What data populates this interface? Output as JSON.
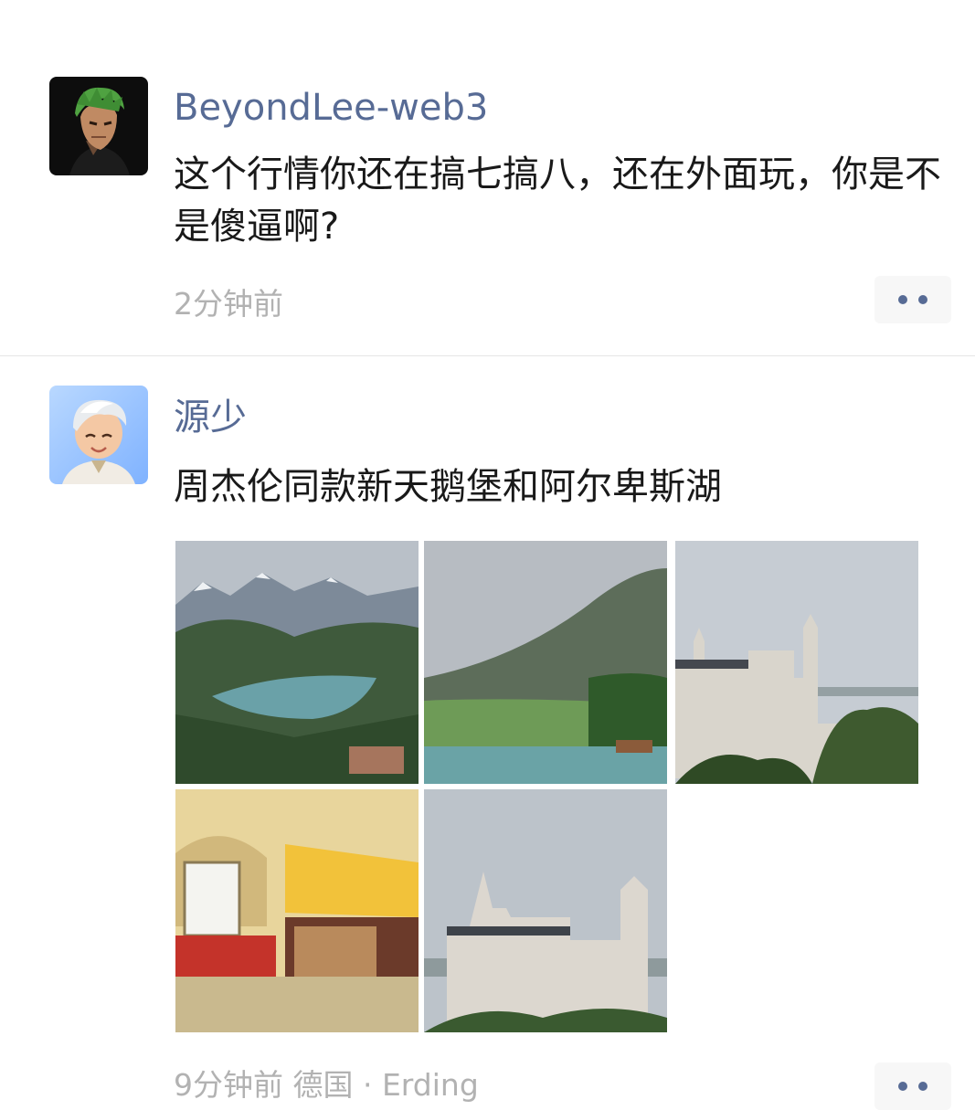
{
  "posts": [
    {
      "author": "BeyondLee-web3",
      "text": "这个行情你还在搞七搞八，还在外面玩，你是不是傻逼啊?",
      "time": "2分钟前"
    },
    {
      "author": "源少",
      "text": "周杰伦同款新天鹅堡和阿尔卑斯湖",
      "time": "9分钟前  德国 · Erding",
      "photos": [
        "alpine-lake",
        "mountain-lake",
        "castle-panorama",
        "storefront",
        "castle"
      ]
    }
  ],
  "colors": {
    "name": "#576b95",
    "body_text": "#191919",
    "timestamp": "#b2b2b2",
    "more_button_bg": "#f7f7f7",
    "divider": "#e5e5e5"
  }
}
